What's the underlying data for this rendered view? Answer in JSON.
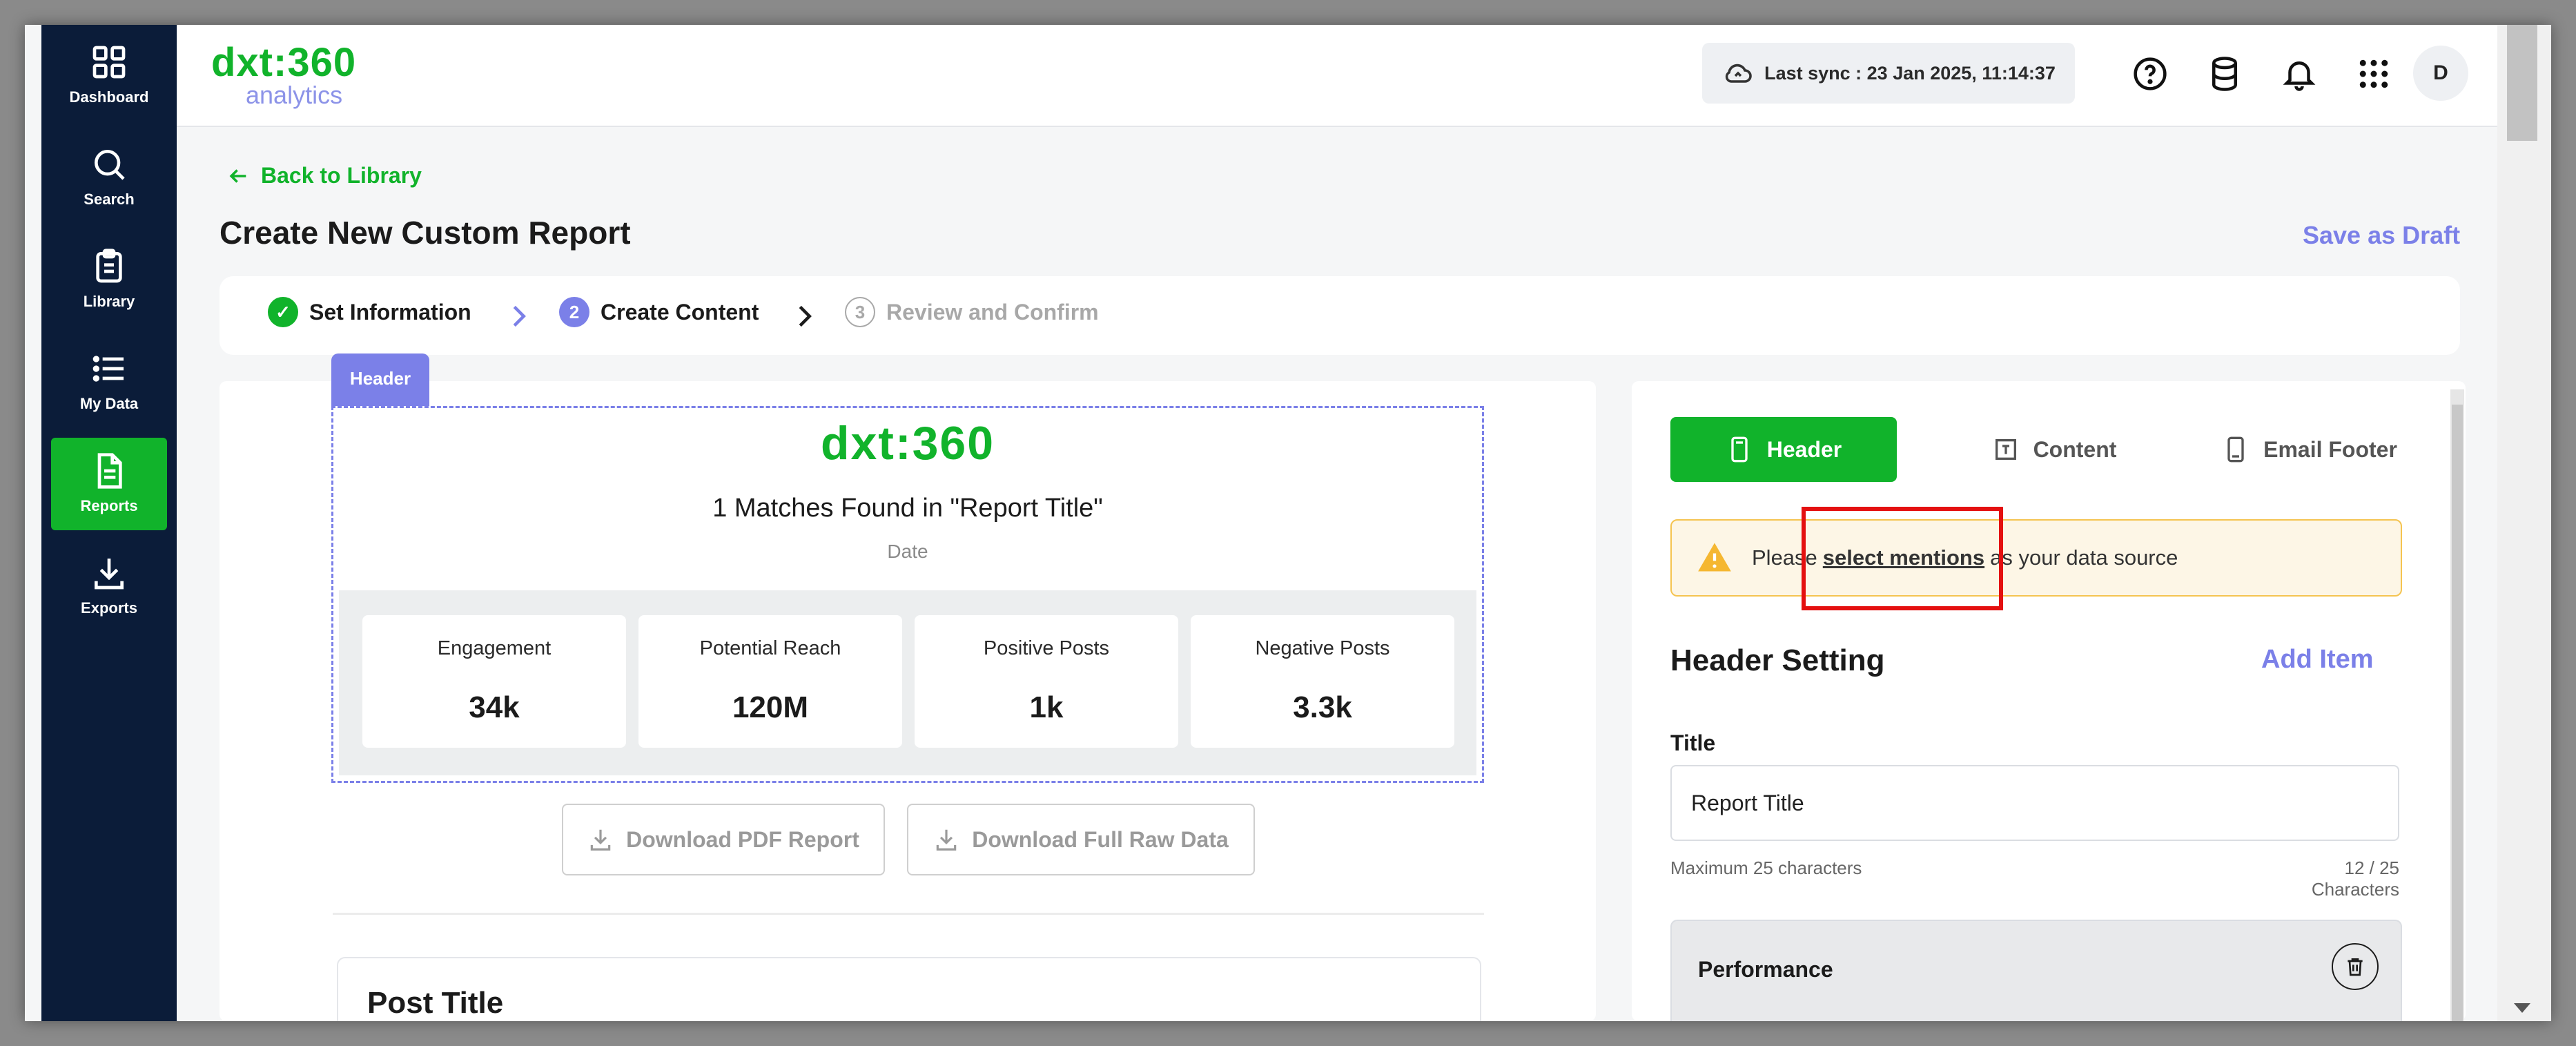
{
  "sidebar": {
    "items": [
      {
        "label": "Dashboard",
        "icon": "grid-icon"
      },
      {
        "label": "Search",
        "icon": "search-icon"
      },
      {
        "label": "Library",
        "icon": "clipboard-icon"
      },
      {
        "label": "My Data",
        "icon": "list-icon"
      },
      {
        "label": "Reports",
        "icon": "document-icon",
        "active": true
      },
      {
        "label": "Exports",
        "icon": "download-icon"
      }
    ]
  },
  "header": {
    "logo_main": "dxt:360",
    "logo_sub": "analytics",
    "sync_text": "Last sync : 23 Jan 2025, 11:14:37",
    "avatar_initial": "D"
  },
  "page": {
    "back_label": "Back to Library",
    "title": "Create New Custom Report",
    "save_draft": "Save as Draft"
  },
  "steps": [
    {
      "number": "✓",
      "label": "Set Information",
      "state": "done"
    },
    {
      "number": "2",
      "label": "Create Content",
      "state": "current"
    },
    {
      "number": "3",
      "label": "Review and Confirm",
      "state": "pending"
    }
  ],
  "preview": {
    "header_tag": "Header",
    "logo": "dxt:360",
    "matches_title": "1 Matches Found in \"Report Title\"",
    "date_label": "Date",
    "stats": [
      {
        "label": "Engagement",
        "value": "34k"
      },
      {
        "label": "Potential Reach",
        "value": "120M"
      },
      {
        "label": "Positive Posts",
        "value": "1k"
      },
      {
        "label": "Negative Posts",
        "value": "3.3k"
      }
    ],
    "download_pdf": "Download PDF Report",
    "download_raw": "Download Full Raw Data",
    "post_title": "Post Title"
  },
  "settings": {
    "tabs": [
      {
        "label": "Header",
        "active": true
      },
      {
        "label": "Content"
      },
      {
        "label": "Email Footer"
      }
    ],
    "alert_prefix": "Please",
    "alert_link": "select mentions",
    "alert_suffix": "as your data source",
    "section_title": "Header Setting",
    "add_item": "Add Item",
    "title_label": "Title",
    "title_value": "Report Title",
    "hint_max": "Maximum 25 characters",
    "hint_count": "12 / 25 Characters",
    "performance_label": "Performance"
  },
  "colors": {
    "brand_green": "#11b32b",
    "accent_purple": "#7b80e8",
    "sidebar_bg": "#0b1c39",
    "alert_bg": "#fdf6e6",
    "highlight_red": "#e41010"
  }
}
